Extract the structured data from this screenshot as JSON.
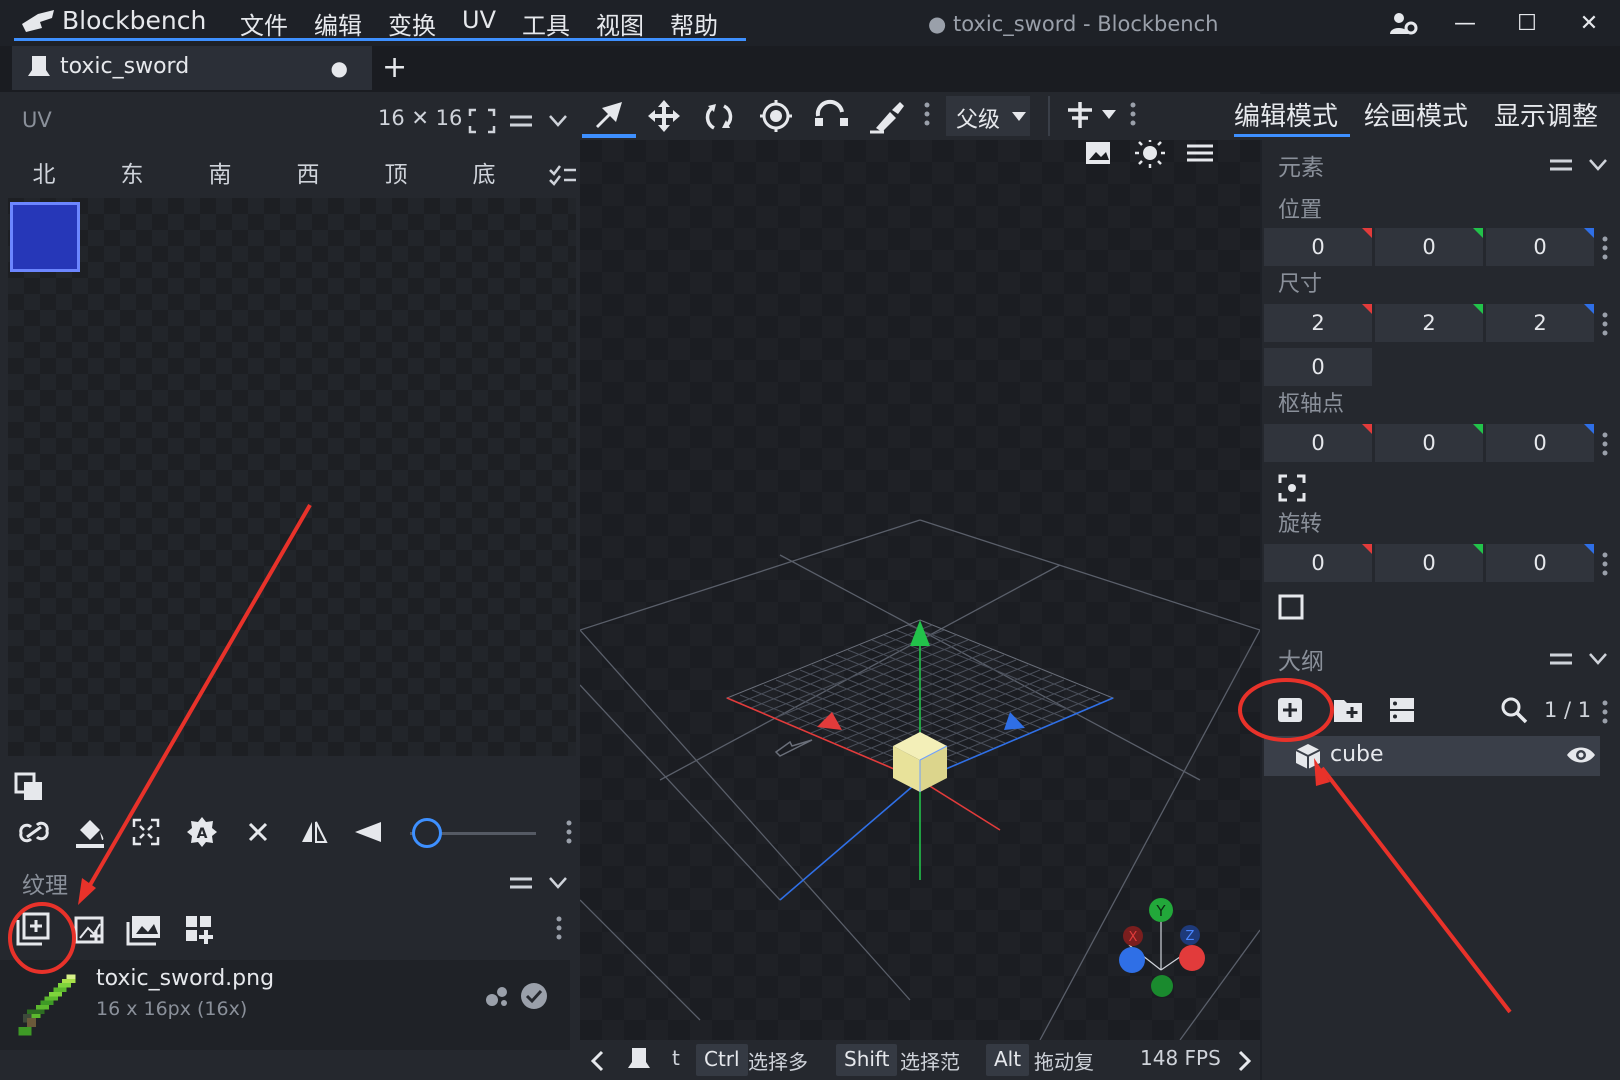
{
  "app": {
    "name": "Blockbench",
    "window_title": "● toxic_sword - Blockbench"
  },
  "menu": [
    "文件",
    "编辑",
    "变换",
    "UV",
    "工具",
    "视图",
    "帮助"
  ],
  "window_controls": {
    "minimize": "—",
    "maximize": "☐",
    "close": "✕"
  },
  "tab": {
    "label": "toxic_sword",
    "unsaved": "●",
    "new": "+"
  },
  "uv_panel": {
    "label": "UV",
    "size": "16 ✕ 16",
    "faces": [
      "北",
      "东",
      "南",
      "西",
      "顶",
      "底"
    ]
  },
  "texture_panel": {
    "label": "纹理",
    "texture": {
      "name": "toxic_sword.png",
      "dimensions": "16 x 16px (16x)"
    }
  },
  "toolbar": {
    "parent_select": "父级",
    "active_tool": "move-tool"
  },
  "modes": [
    "编辑模式",
    "绘画模式",
    "显示调整"
  ],
  "element_panel": {
    "title": "元素",
    "position_label": "位置",
    "position": [
      "0",
      "0",
      "0"
    ],
    "size_label": "尺寸",
    "size": [
      "2",
      "2",
      "2"
    ],
    "inflate": "0",
    "pivot_label": "枢轴点",
    "pivot": [
      "0",
      "0",
      "0"
    ],
    "rotation_label": "旋转",
    "rotation": [
      "0",
      "0",
      "0"
    ]
  },
  "outliner": {
    "title": "大纲",
    "count": "1 / 1",
    "items": [
      {
        "name": "cube"
      }
    ]
  },
  "status": {
    "t_label": "t",
    "ctrl_key": "Ctrl",
    "ctrl_text": "选择多",
    "shift_key": "Shift",
    "shift_text": "选择范",
    "alt_key": "Alt",
    "alt_text": "拖动复",
    "fps": "148 FPS"
  },
  "gizmo_axes": {
    "y": "Y",
    "x": "X",
    "z": "Z"
  },
  "colors": {
    "accent": "#3e90ff",
    "x_axis": "#e23b3b",
    "y_axis": "#22c24a",
    "z_axis": "#2f6fe6",
    "annotation": "#e8322a",
    "texture_blue": "#2637b8"
  }
}
